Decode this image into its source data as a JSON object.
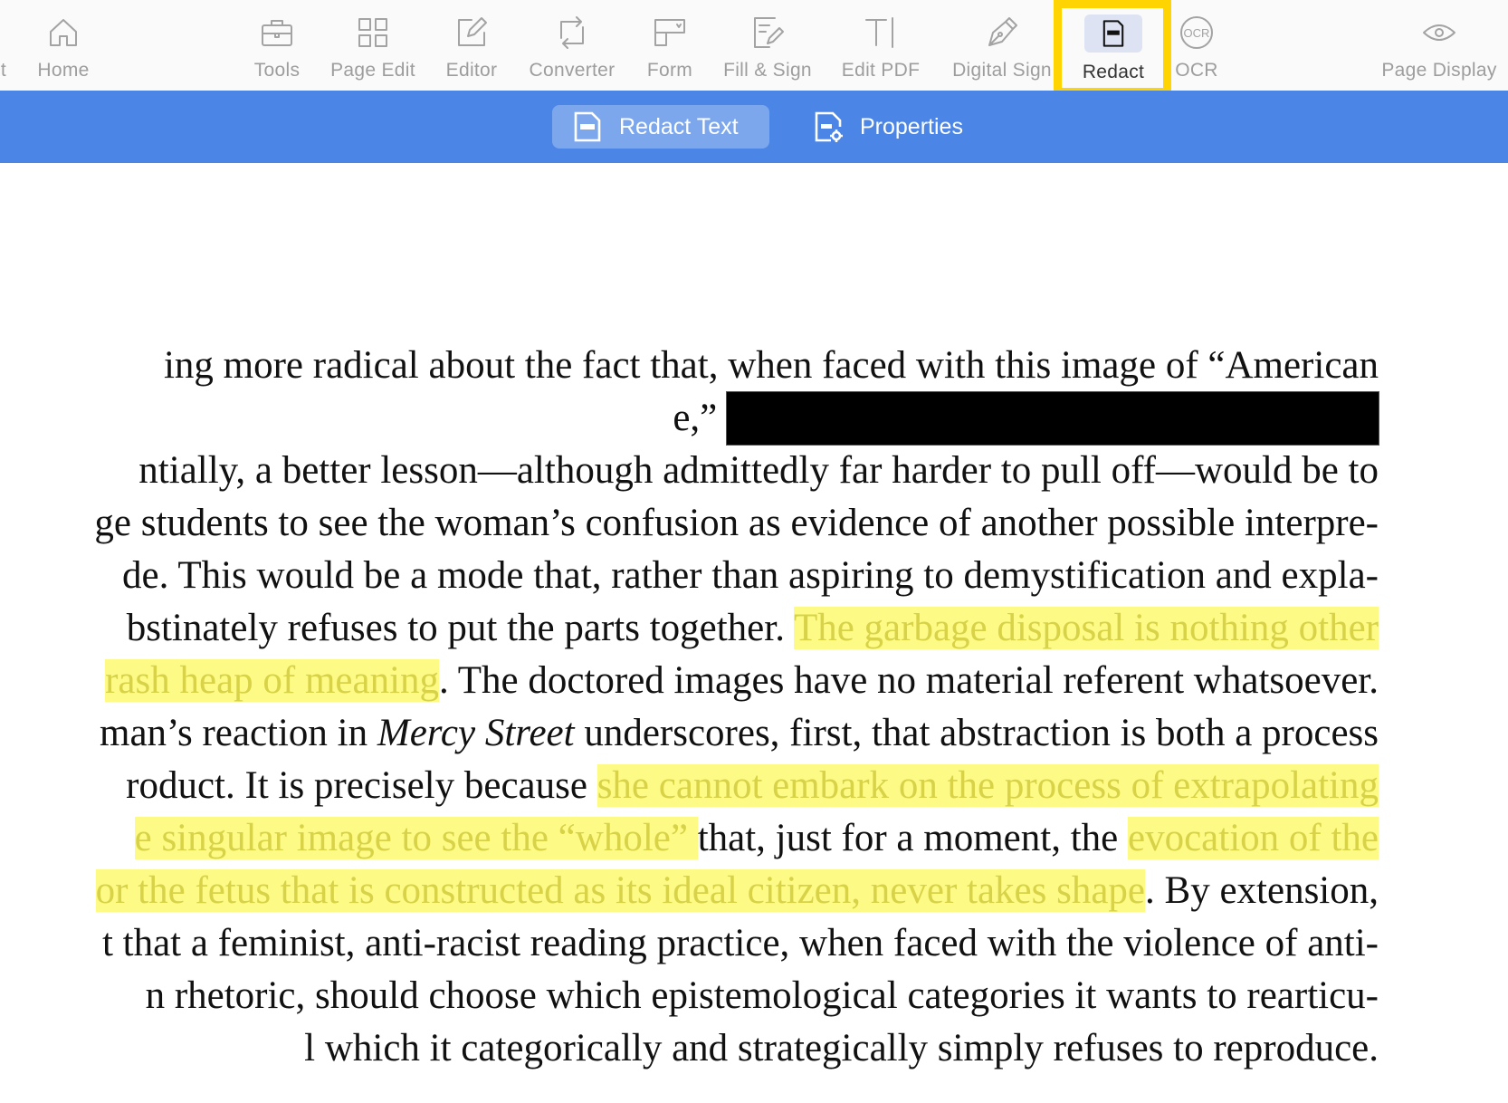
{
  "toolbar": {
    "items": [
      {
        "label": "t",
        "icon": "truncated-icon"
      },
      {
        "label": "Home",
        "icon": "home-icon"
      },
      {
        "label": "Tools",
        "icon": "briefcase-icon"
      },
      {
        "label": "Page Edit",
        "icon": "grid-icon"
      },
      {
        "label": "Editor",
        "icon": "edit-icon"
      },
      {
        "label": "Converter",
        "icon": "convert-icon"
      },
      {
        "label": "Form",
        "icon": "form-icon"
      },
      {
        "label": "Fill & Sign",
        "icon": "fill-sign-icon"
      },
      {
        "label": "Edit PDF",
        "icon": "text-cursor-icon"
      },
      {
        "label": "Digital Sign",
        "icon": "pen-nib-icon"
      },
      {
        "label": "Redact",
        "icon": "redact-icon",
        "active": true
      },
      {
        "label": "OCR",
        "icon": "ocr-icon"
      },
      {
        "label": "Page Display",
        "icon": "eye-icon"
      }
    ]
  },
  "subbar": {
    "redact_text": "Redact Text",
    "properties": "Properties",
    "background": "#4b86e7"
  },
  "document": {
    "lines": [
      [
        {
          "t": "ing more radical about the fact that, when faced with this image of “American"
        }
      ],
      [
        {
          "t": "e,” "
        },
        {
          "redacted": true
        }
      ],
      [
        {
          "t": "ntially, a better lesson—although admittedly far harder to pull off—would be to"
        }
      ],
      [
        {
          "t": "ge students to see the woman’s confusion as evidence of another possible interpre-"
        }
      ],
      [
        {
          "t": "de. This would be a mode that, rather than aspiring to demystification and expla-"
        }
      ],
      [
        {
          "t": "bstinately refuses to put the parts together. "
        },
        {
          "t": "The garbage disposal is nothing other",
          "hl": true
        }
      ],
      [
        {
          "t": "rash heap of meaning",
          "hl": true
        },
        {
          "t": ". The doctored images have no material referent whatsoever."
        }
      ],
      [
        {
          "t": "man’s reaction in "
        },
        {
          "t": "Mercy Street",
          "i": true
        },
        {
          "t": " underscores, first, that abstraction is both a process"
        }
      ],
      [
        {
          "t": "roduct. It is precisely because "
        },
        {
          "t": "she cannot embark on the process of extrapolating",
          "hl": true
        }
      ],
      [
        {
          "t": "e singular image to see the “whole” ",
          "hl": true
        },
        {
          "t": "that, just for a moment, the "
        },
        {
          "t": "evocation of the",
          "hl": true
        }
      ],
      [
        {
          "t": "or the fetus that is constructed as its ideal citizen, never takes shape",
          "hl": true
        },
        {
          "t": ". By extension,"
        }
      ],
      [
        {
          "t": "t that a feminist, anti-racist reading practice, when faced with the violence of anti-"
        }
      ],
      [
        {
          "t": "n rhetoric, should choose which epistemological categories it wants to rearticu-"
        }
      ],
      [
        {
          "t": "l which it categorically and strategically simply refuses to reproduce."
        }
      ]
    ],
    "highlight_color": "#fdfb85",
    "highlight_text_color": "#d7d248"
  }
}
